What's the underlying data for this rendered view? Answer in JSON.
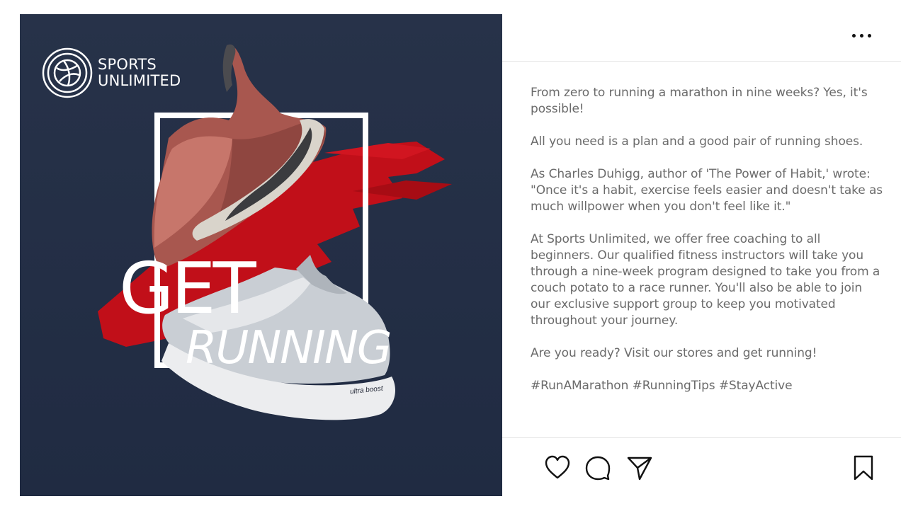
{
  "post": {
    "brand_logo": {
      "line1": "SPORTS",
      "line2": "UNLIMITED",
      "icon": "basketball-icon"
    },
    "headline": {
      "line1": "GET",
      "line2": "RUNNING"
    },
    "shoe_text": "ultra boost",
    "colors": {
      "background": "#243047",
      "brush_stroke": "#c8101a",
      "shoe_top": "#b8645c",
      "shoe_bottom": "#c7ccd3"
    }
  },
  "header": {
    "more_icon": "more-horizontal-icon"
  },
  "caption": {
    "paragraphs": [
      "From zero to running a marathon in nine weeks? Yes, it's possible!",
      "All you need is a plan and a good pair of running shoes.",
      "As Charles Duhigg, author of 'The Power of Habit,' wrote: \"Once it's a habit, exercise feels easier and doesn't take as much willpower when you don't feel like it.\"",
      "At Sports Unlimited, we offer free coaching to all beginners. Our qualified fitness instructors will take you through a nine-week program designed to take you from a couch potato to a race runner. You'll also be able to join our exclusive support group to keep you motivated throughout your journey.",
      "Are you ready? Visit our stores and get running!",
      "#RunAMarathon #RunningTips #StayActive"
    ]
  },
  "actions": {
    "like_icon": "heart-icon",
    "comment_icon": "comment-icon",
    "share_icon": "send-icon",
    "save_icon": "bookmark-icon"
  }
}
